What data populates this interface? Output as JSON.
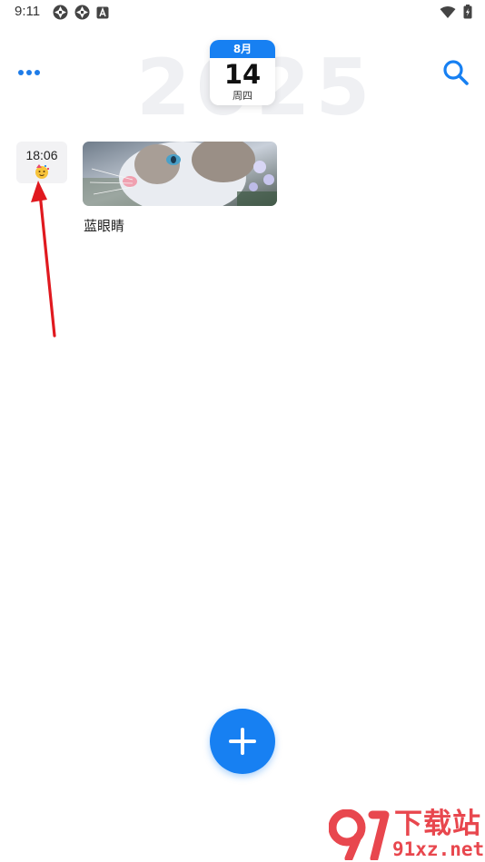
{
  "status_bar": {
    "time": "9:11",
    "left_icons": [
      "aperture-icon",
      "aperture-icon",
      "font-a-icon"
    ],
    "right_icons": [
      "wifi-icon",
      "battery-charging-icon"
    ]
  },
  "header": {
    "year": "2025",
    "calendar": {
      "month": "8月",
      "day": "14",
      "weekday": "周四"
    },
    "accent_color": "#1780f2"
  },
  "entries": [
    {
      "time": "18:06",
      "mood_icon": "party-face-emoji",
      "image": "blue-eyed-cat-photo",
      "title": "蓝眼睛"
    }
  ],
  "fab": {
    "icon": "plus-icon"
  },
  "annotation": {
    "color": "#e0191f"
  },
  "watermark": {
    "line1": "下载站",
    "line2": "91xz.net",
    "color": "#e8474e"
  }
}
